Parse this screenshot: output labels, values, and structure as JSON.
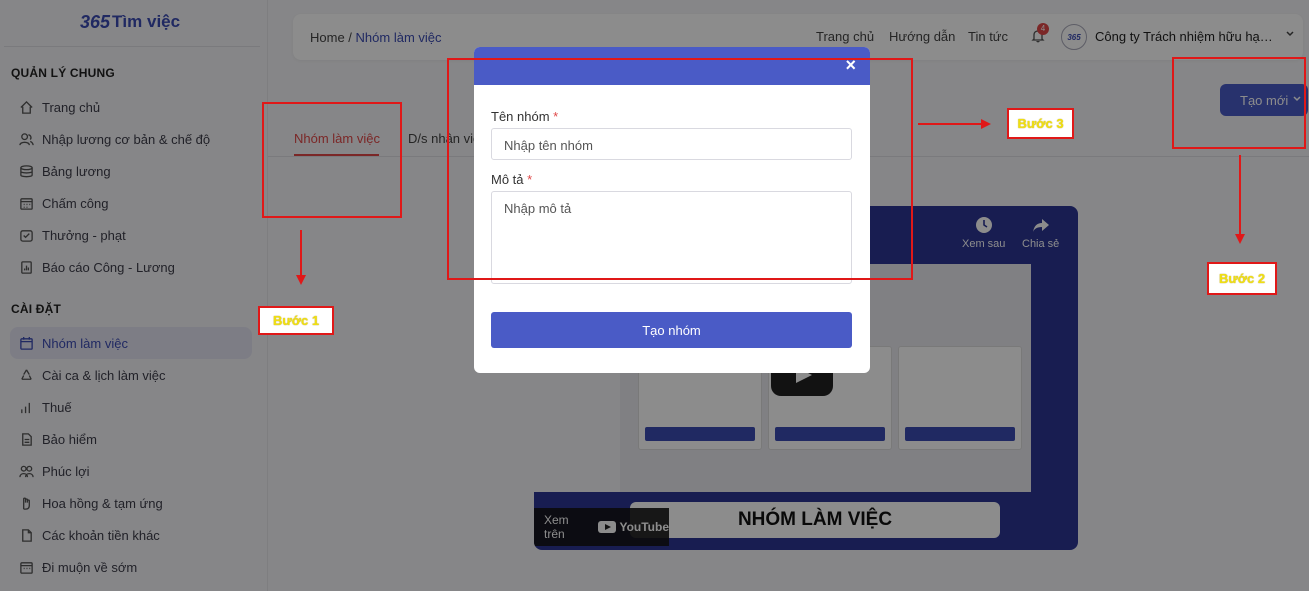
{
  "logo": {
    "num": "365",
    "text": "Tìm việc"
  },
  "sidebar": {
    "section1": "QUẢN LÝ CHUNG",
    "section2": "CÀI ĐẶT",
    "items1": [
      {
        "label": "Trang chủ",
        "icon": "home-icon"
      },
      {
        "label": "Nhập lương cơ bản & chế độ",
        "icon": "users-icon"
      },
      {
        "label": "Bảng lương",
        "icon": "coins-icon"
      },
      {
        "label": "Chấm công",
        "icon": "calendar-grid-icon"
      },
      {
        "label": "Thưởng - phạt",
        "icon": "check-calendar-icon"
      },
      {
        "label": "Báo cáo Công - Lương",
        "icon": "report-icon"
      }
    ],
    "items2": [
      {
        "label": "Nhóm làm việc",
        "icon": "calendar-icon",
        "active": true
      },
      {
        "label": "Cài ca & lịch làm việc",
        "icon": "recycle-icon"
      },
      {
        "label": "Thuế",
        "icon": "bar-chart-icon"
      },
      {
        "label": "Bảo hiểm",
        "icon": "document-icon"
      },
      {
        "label": "Phúc lợi",
        "icon": "people-icon"
      },
      {
        "label": "Hoa hồng & tạm ứng",
        "icon": "hand-icon"
      },
      {
        "label": "Các khoản tiền khác",
        "icon": "file-icon"
      },
      {
        "label": "Đi muộn về sớm",
        "icon": "grid-calendar-icon"
      }
    ]
  },
  "header": {
    "breadcrumb_home": "Home /",
    "breadcrumb_current": "Nhóm làm việc",
    "links": [
      "Trang chủ",
      "Hướng dẫn",
      "Tin tức"
    ],
    "notification_count": "4",
    "avatar_text": "365",
    "company": "Công ty Trách nhiệm hữu hạn Phương Anh"
  },
  "main": {
    "create_button": "Tạo mới",
    "tabs": [
      "Nhóm làm việc",
      "D/s nhân viên"
    ]
  },
  "video": {
    "watch_later": "Xem sau",
    "share": "Chia sẻ",
    "watch_on": "Xem trên",
    "youtube": "YouTube",
    "banner": "NHÓM LÀM VIỆC"
  },
  "modal": {
    "name_label": "Tên nhóm",
    "name_placeholder": "Nhập tên nhóm",
    "desc_label": "Mô tả",
    "desc_placeholder": "Nhập mô tả",
    "required_mark": "*",
    "submit_label": "Tạo nhóm",
    "close_symbol": "×"
  },
  "annotations": {
    "step1": "Bước 1",
    "step2": "Bước 2",
    "step3": "Bước 3",
    "color": "#e01818"
  }
}
